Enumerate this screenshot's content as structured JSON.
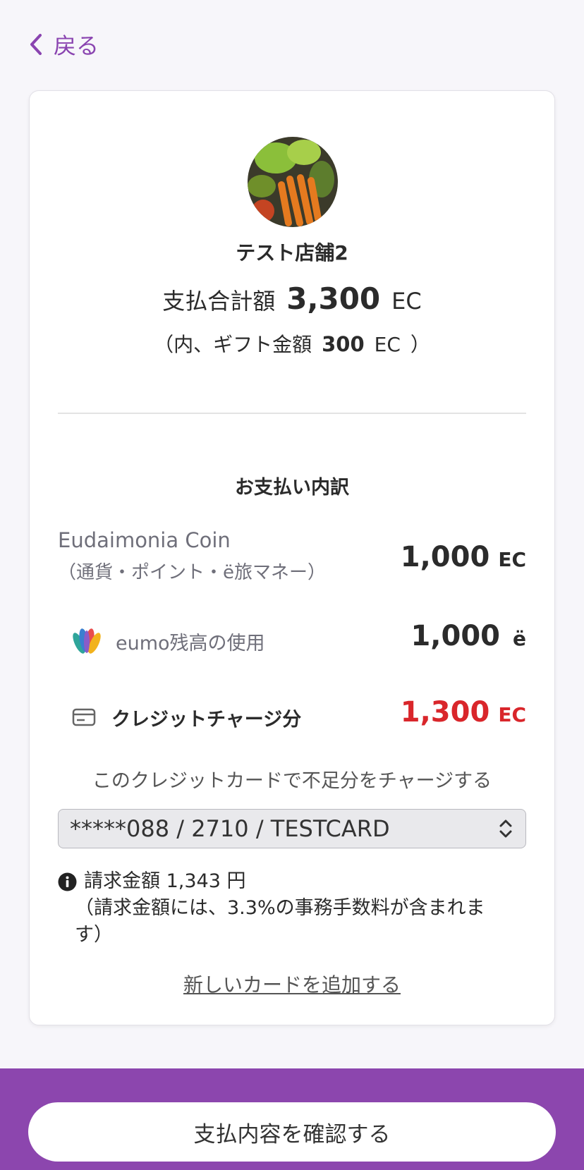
{
  "nav": {
    "back_label": "戻る"
  },
  "shop": {
    "name": "テスト店舗2"
  },
  "total": {
    "label": "支払合計額",
    "amount": "3,300",
    "unit": "EC"
  },
  "gift": {
    "prefix": "（内、ギフト金額",
    "amount": "300",
    "unit": "EC",
    "suffix": "）"
  },
  "breakdown": {
    "title": "お支払い内訳",
    "ec": {
      "label": "Eudaimonia Coin",
      "sub_label": "（通貨・ポイント・ë旅マネー）",
      "amount": "1,000",
      "unit": "EC"
    },
    "eumo": {
      "label": "eumo残高の使用",
      "amount": "1,000",
      "unit": "ë"
    },
    "credit": {
      "label": "クレジットチャージ分",
      "amount": "1,300",
      "unit": "EC",
      "color": "#d9262b"
    }
  },
  "charge": {
    "note": "このクレジットカードで不足分をチャージする",
    "selected_card": "*****088 / 2710 / TESTCARD",
    "billing_line": "請求金額 1,343 円",
    "fee_note": "（請求金額には、3.3%の事務手数料が含まれます）",
    "add_card_label": "新しいカードを追加する"
  },
  "footer": {
    "confirm_label": "支払内容を確認する"
  },
  "colors": {
    "accent": "#8c46ae",
    "alert": "#d9262b"
  }
}
